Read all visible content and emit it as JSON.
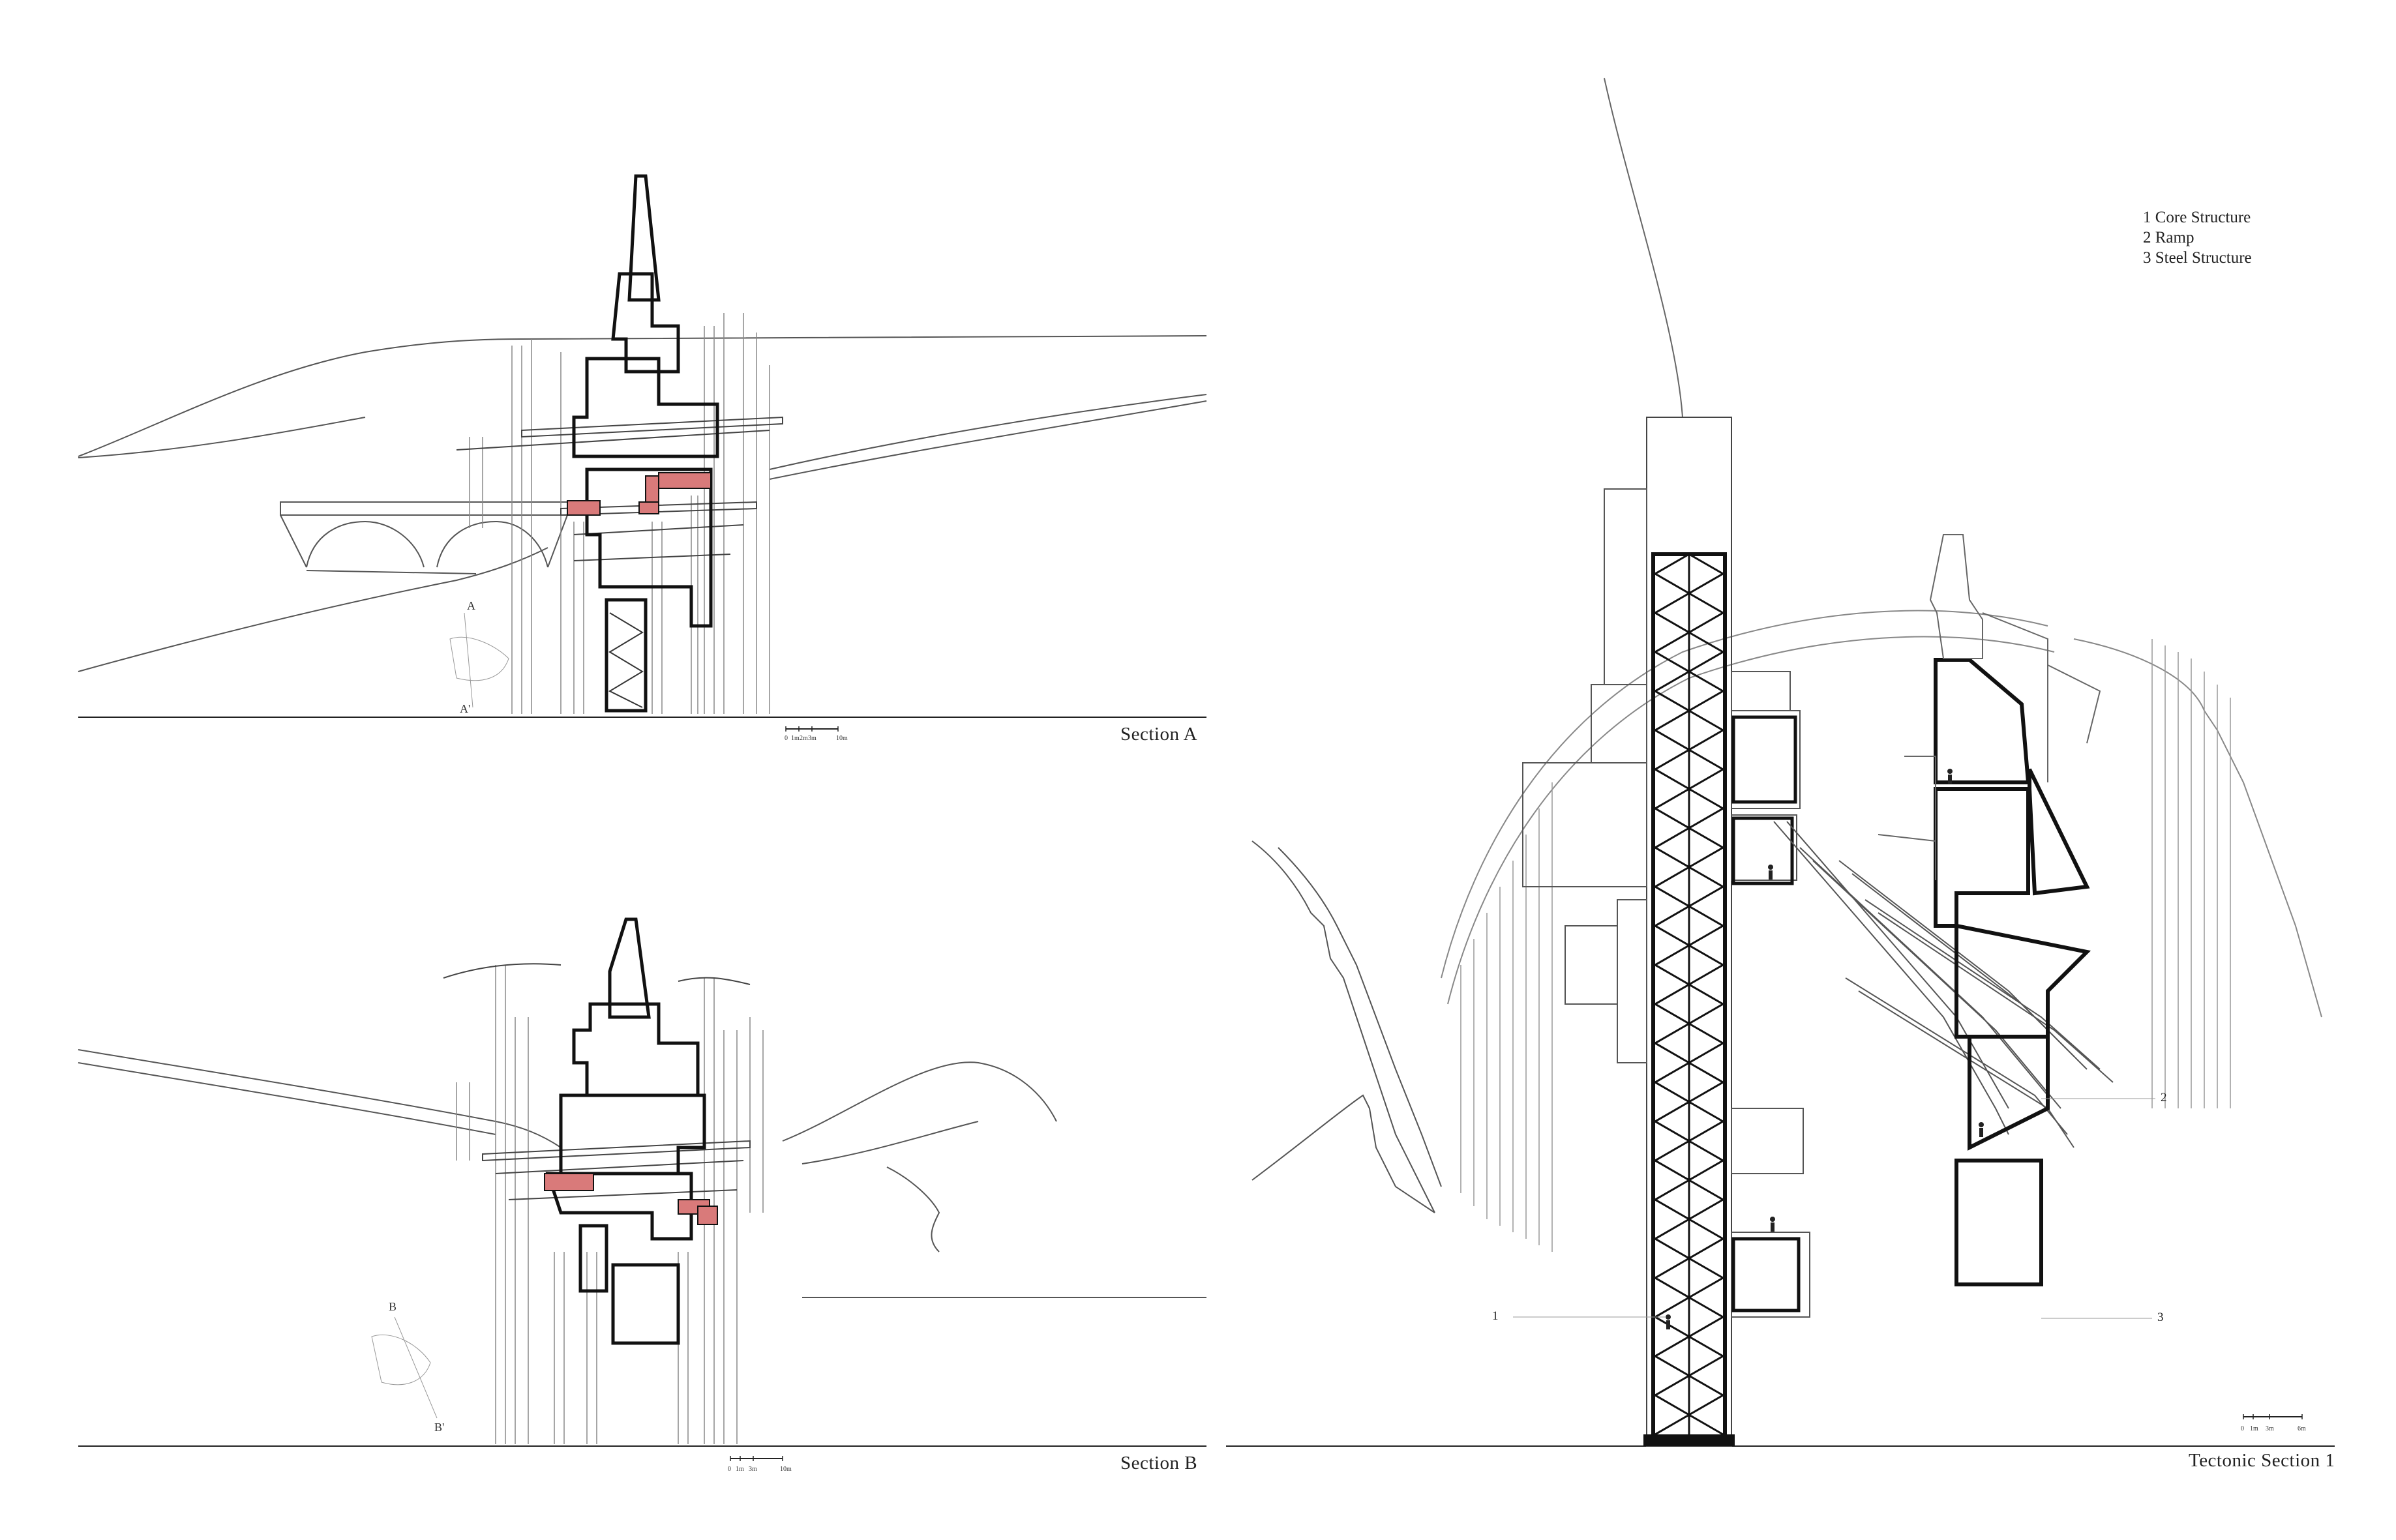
{
  "sections": {
    "section_a": {
      "title": "Section A",
      "mark_top": "A",
      "mark_bottom": "A'",
      "scale": [
        "0",
        "1m",
        "2m",
        "3m",
        "10m"
      ]
    },
    "section_b": {
      "title": "Section B",
      "mark_top": "B",
      "mark_bottom": "B'",
      "scale": [
        "0",
        "1m",
        "3m",
        "10m"
      ]
    },
    "tectonic": {
      "title": "Tectonic Section 1",
      "scale": [
        "0",
        "1m",
        "3m",
        "6m"
      ]
    }
  },
  "legend": [
    {
      "num": "1",
      "label": "Core Structure"
    },
    {
      "num": "2",
      "label": "Ramp"
    },
    {
      "num": "3",
      "label": "Steel Structure"
    }
  ],
  "callouts": {
    "c1": "1",
    "c2": "2",
    "c3": "3"
  },
  "colors": {
    "line": "#222222",
    "thin": "#777777",
    "highlight": "#d97a7a",
    "background": "#ffffff"
  }
}
